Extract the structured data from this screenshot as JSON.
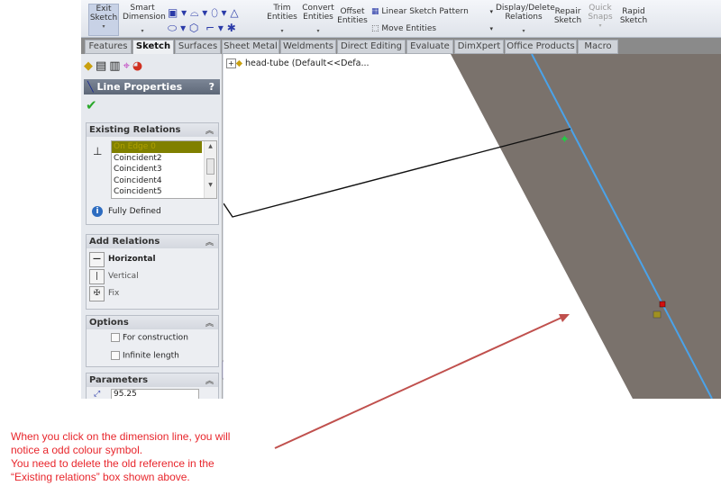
{
  "toolbar": {
    "exit_sketch": "Exit Sketch",
    "smart_dimension": "Smart Dimension",
    "trim_entities": "Trim Entities",
    "convert_entities": "Convert Entities",
    "offset_entities": "Offset Entities",
    "linear_sketch_pattern": "Linear Sketch Pattern",
    "move_entities": "Move Entities",
    "display_delete_relations": "Display/Delete Relations",
    "repair_sketch": "Repair Sketch",
    "quick_snaps": "Quick Snaps",
    "rapid_sketch": "Rapid Sketch"
  },
  "tabs": [
    "Features",
    "Sketch",
    "Surfaces",
    "Sheet Metal",
    "Weldments",
    "Direct Editing",
    "Evaluate",
    "DimXpert",
    "Office Products",
    "Macro"
  ],
  "panel": {
    "title": "Line Properties",
    "help": "?",
    "existing_relations": {
      "header": "Existing Relations",
      "items": [
        "On Edge 0",
        "Coincident2",
        "Coincident3",
        "Coincident4",
        "Coincident5"
      ],
      "status": "Fully Defined"
    },
    "add_relations": {
      "header": "Add Relations",
      "items": [
        "Horizontal",
        "Vertical",
        "Fix"
      ]
    },
    "options": {
      "header": "Options",
      "items": [
        "For construction",
        "Infinite length"
      ]
    },
    "parameters": {
      "header": "Parameters",
      "value": "95.25"
    }
  },
  "tree": {
    "root": "head-tube  (Default<<Defa..."
  },
  "note": [
    "When you click on the dimension line, you will",
    "notice a odd colour symbol.",
    "You need to delete the old reference in the",
    "“Existing relations” box shown above."
  ],
  "colors": {
    "plane": "#7a726c",
    "sketch_line": "#4aa3ea",
    "annotation": "#e8262c",
    "selected": "#808000"
  }
}
